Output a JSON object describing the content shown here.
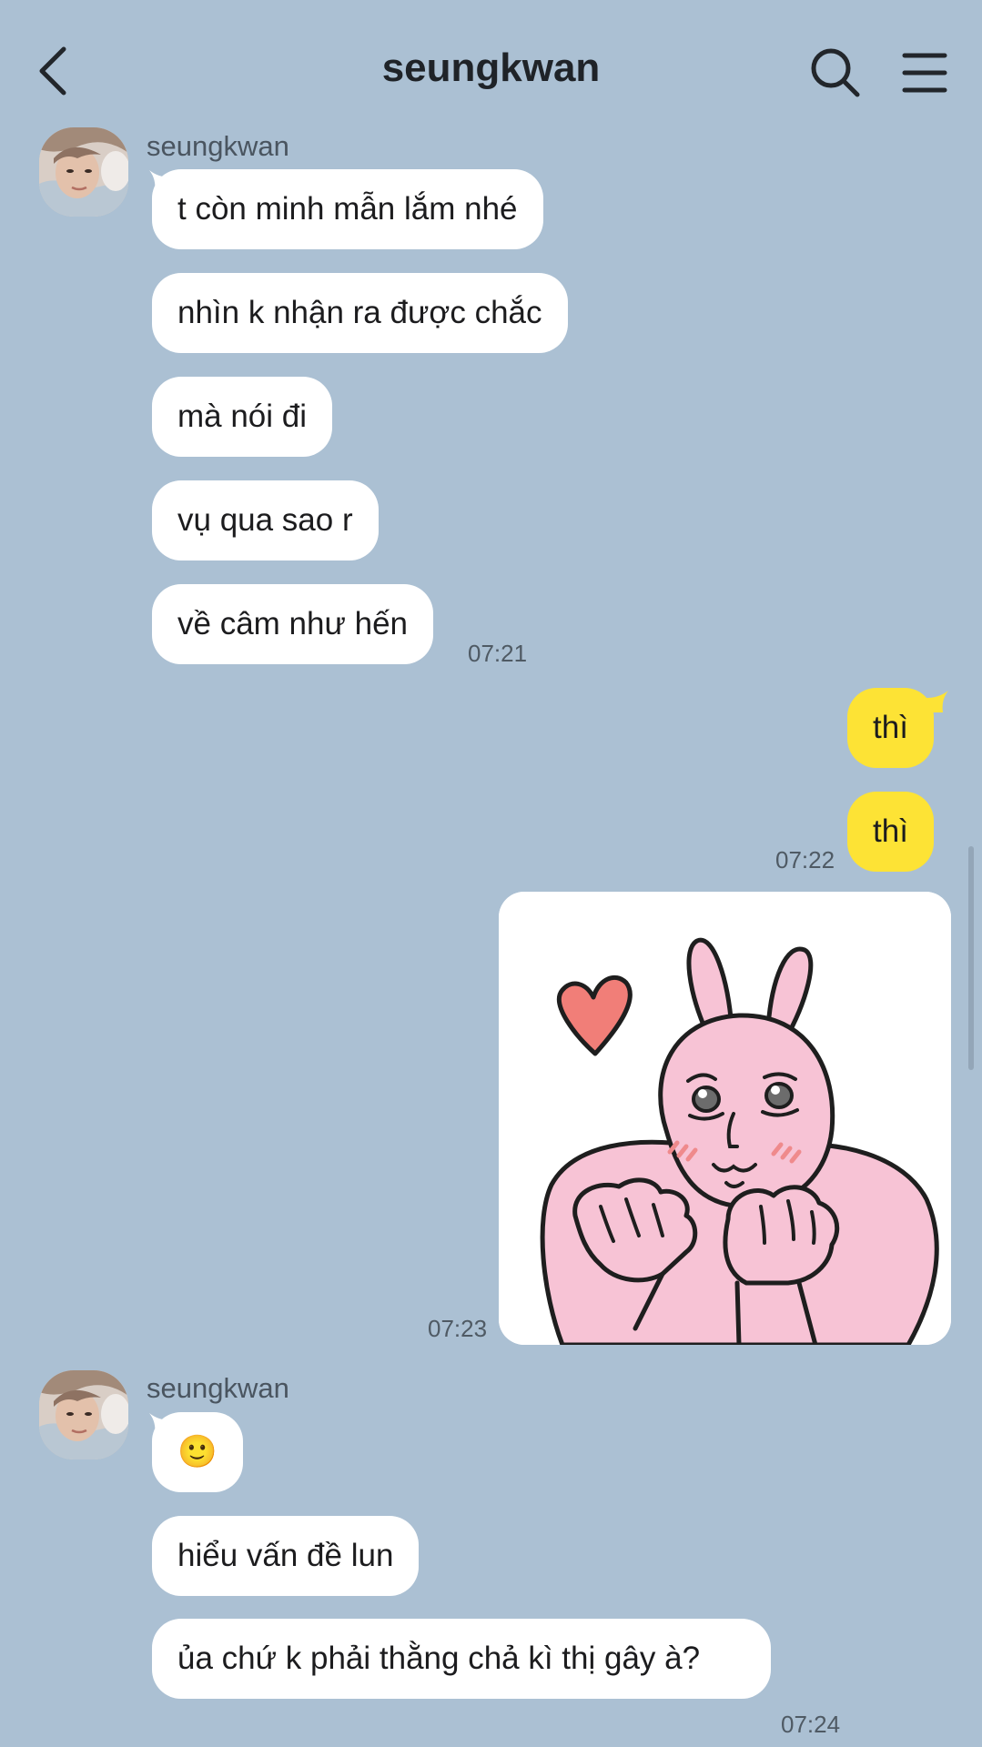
{
  "header": {
    "title": "seungkwan",
    "back_icon": "chevron-left-icon",
    "search_icon": "search-icon",
    "menu_icon": "hamburger-menu-icon"
  },
  "colors": {
    "background": "#abc0d3",
    "incoming_bubble": "#ffffff",
    "outgoing_bubble": "#fde335",
    "text": "#1c1c1e",
    "timestamp": "#4f5a64"
  },
  "groups": [
    {
      "sender": "seungkwan",
      "messages": [
        "t còn minh mẫn lắm nhé",
        "nhìn k nhận ra được chắc",
        "mà nói đi",
        "vụ qua sao r",
        "về câm như hến"
      ],
      "time": "07:21"
    },
    {
      "sender": "me",
      "messages": [
        "thì",
        "thì"
      ],
      "time": "07:22"
    },
    {
      "sender": "me",
      "sticker": "pink-rabbit-sticker",
      "time": "07:23"
    },
    {
      "sender": "seungkwan",
      "messages": [
        "🙂",
        "hiểu vấn đề lun",
        "ủa chứ k phải thằng chả kì thị gây à?"
      ],
      "time": "07:24"
    }
  ]
}
